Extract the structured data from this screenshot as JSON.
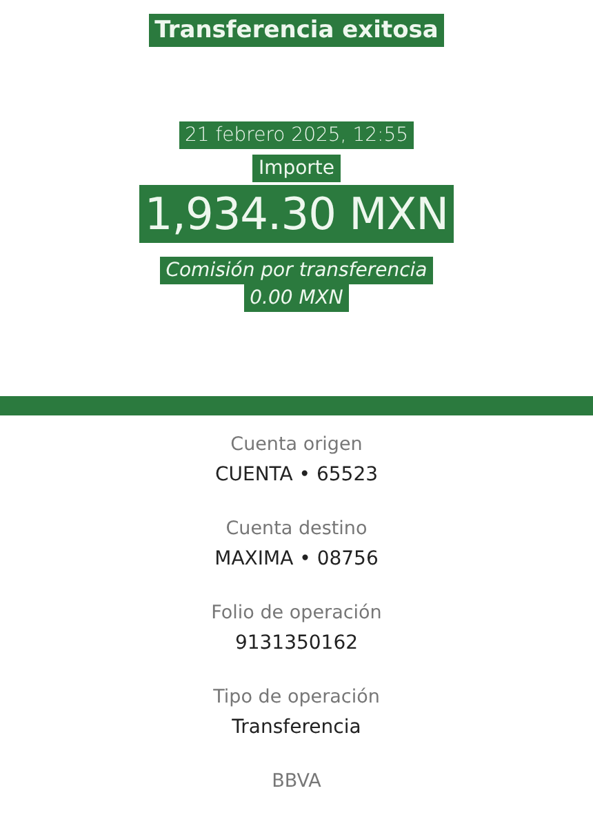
{
  "title": "Transferencia exitosa",
  "date": "21 febrero 2025, 12:55",
  "amount_label": "Importe",
  "amount": "1,934.30 MXN",
  "fee_label": "Comisión por transferencia",
  "fee": "0.00 MXN",
  "details": [
    {
      "label": "Cuenta origen",
      "value": "CUENTA • 65523"
    },
    {
      "label": "Cuenta destino",
      "value": "MAXIMA • 08756"
    },
    {
      "label": "Folio de operación",
      "value": "9131350162"
    },
    {
      "label": "Tipo de operación",
      "value": "Transferencia"
    }
  ],
  "bank_label": "BBVA"
}
